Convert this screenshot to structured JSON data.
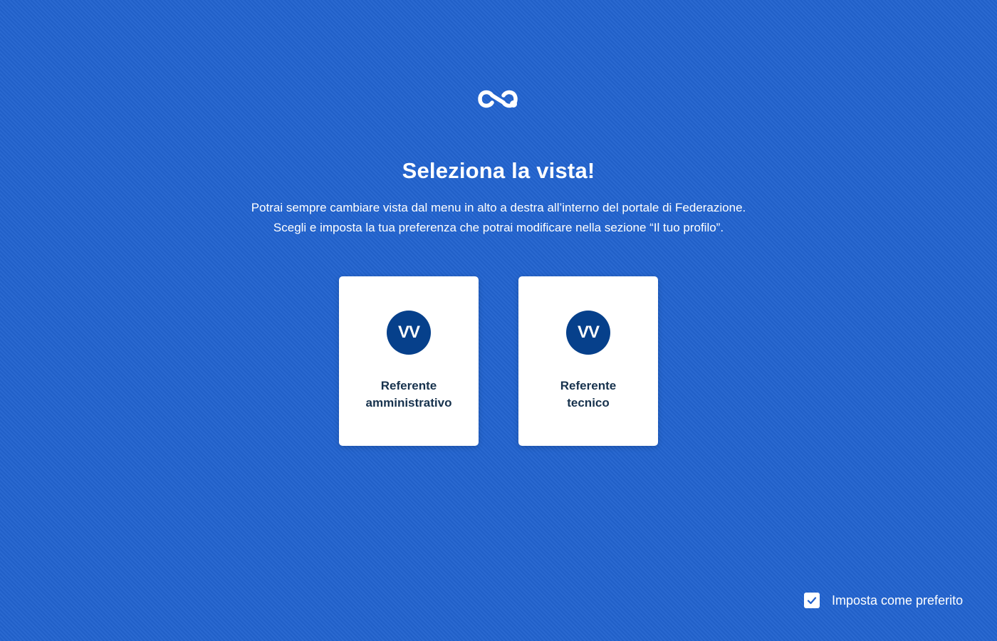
{
  "page": {
    "title": "Seleziona la vista!",
    "subtitle_line1": "Potrai sempre cambiare vista dal menu in alto a destra all’interno del portale di Federazione.",
    "subtitle_line2": "Scegli e imposta la tua preferenza che potrai modificare nella sezione “Il tuo profilo”."
  },
  "cards": [
    {
      "avatar_initials": "VV",
      "label_line1": "Referente",
      "label_line2": "amministrativo"
    },
    {
      "avatar_initials": "VV",
      "label_line1": "Referente",
      "label_line2": "tecnico"
    }
  ],
  "preference": {
    "checked": true,
    "label": "Imposta come preferito"
  },
  "icons": {
    "logo": "federation-logo-icon",
    "check": "check-icon"
  },
  "colors": {
    "background": "#2264cf",
    "avatar": "#06408b",
    "card_text": "#17324d",
    "check": "#1f5fcc"
  }
}
